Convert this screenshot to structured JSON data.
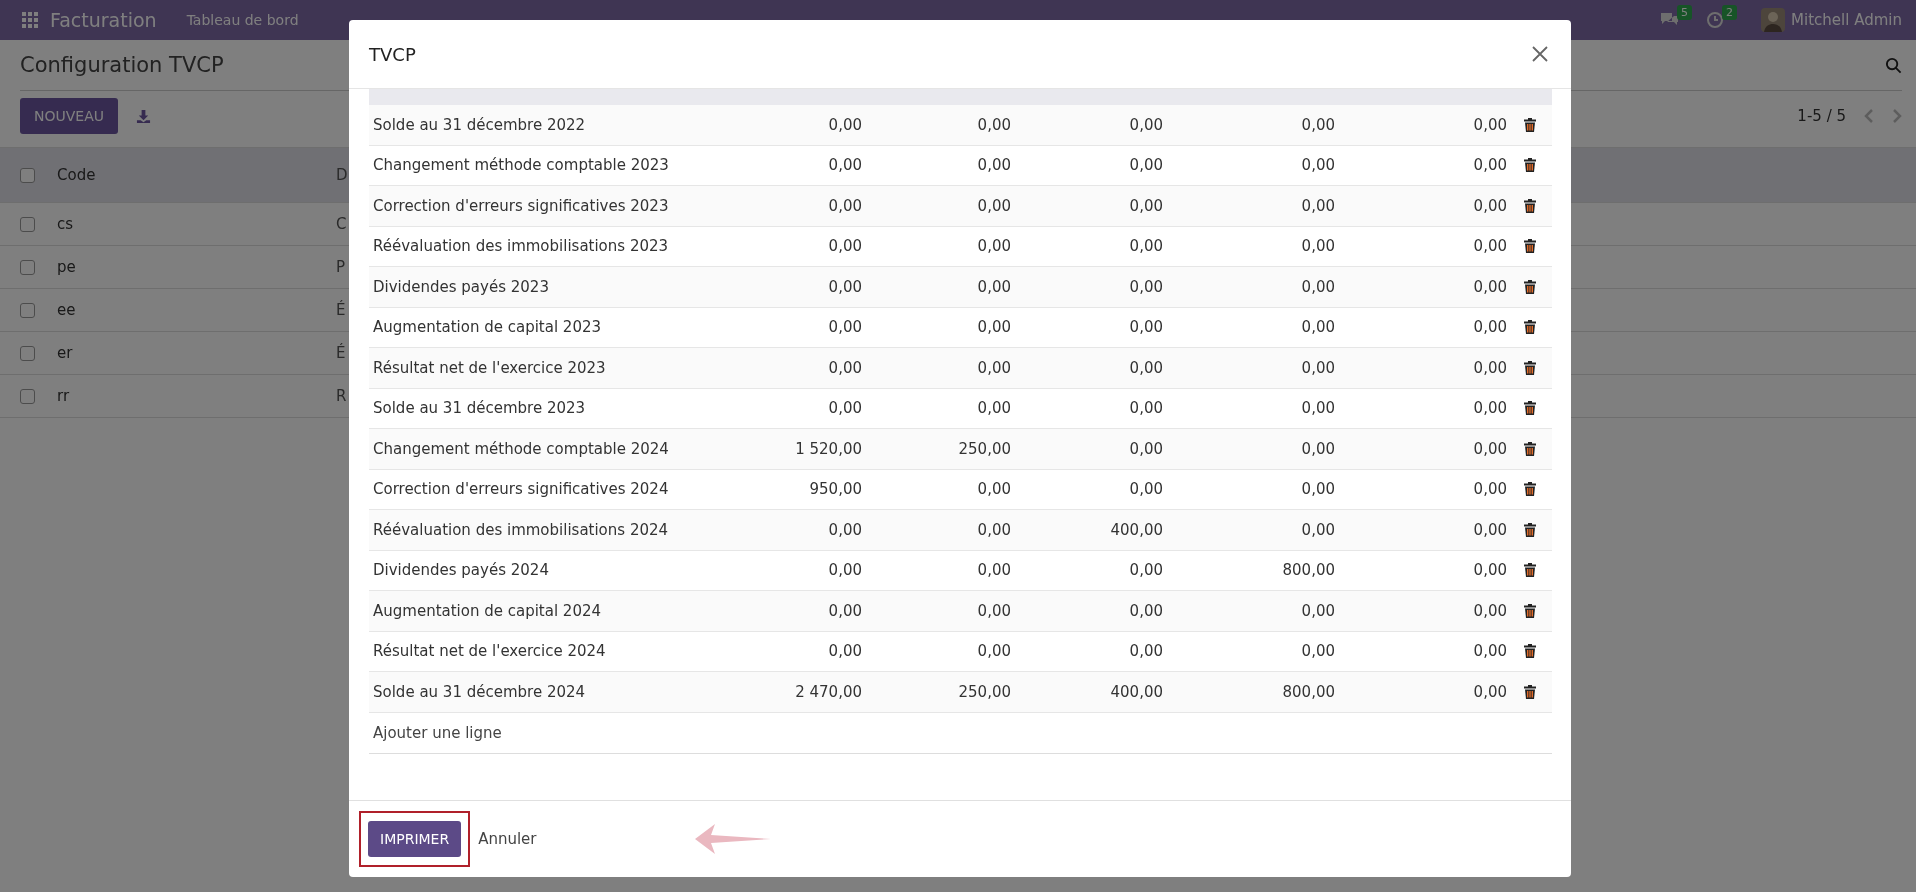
{
  "navbar": {
    "app_name": "Facturation",
    "menu": [
      "Tableau de bord"
    ],
    "messages_badge": "5",
    "activities_badge": "2",
    "user_name": "Mitchell Admin"
  },
  "page": {
    "title": "Configuration TVCP",
    "new_button": "NOUVEAU",
    "pager": "1-5 / 5",
    "list": {
      "columns": [
        "Code",
        "D"
      ],
      "header_checked": false,
      "rows": [
        {
          "code": "cs",
          "column_2": "C",
          "checked": false
        },
        {
          "code": "pe",
          "column_2": "P",
          "checked": false
        },
        {
          "code": "ee",
          "column_2": "É",
          "checked": false
        },
        {
          "code": "er",
          "column_2": "É",
          "checked": false
        },
        {
          "code": "rr",
          "column_2": "R",
          "checked": false
        }
      ]
    }
  },
  "dialog": {
    "title": "TVCP",
    "rows": [
      {
        "label": "Solde au 31 décembre 2022",
        "values": [
          "0,00",
          "0,00",
          "0,00",
          "0,00",
          "0,00"
        ]
      },
      {
        "label": "Changement méthode comptable 2023",
        "values": [
          "0,00",
          "0,00",
          "0,00",
          "0,00",
          "0,00"
        ]
      },
      {
        "label": "Correction d'erreurs significatives 2023",
        "values": [
          "0,00",
          "0,00",
          "0,00",
          "0,00",
          "0,00"
        ]
      },
      {
        "label": "Réévaluation des immobilisations 2023",
        "values": [
          "0,00",
          "0,00",
          "0,00",
          "0,00",
          "0,00"
        ]
      },
      {
        "label": "Dividendes payés 2023",
        "values": [
          "0,00",
          "0,00",
          "0,00",
          "0,00",
          "0,00"
        ]
      },
      {
        "label": "Augmentation de capital 2023",
        "values": [
          "0,00",
          "0,00",
          "0,00",
          "0,00",
          "0,00"
        ]
      },
      {
        "label": "Résultat net de l'exercice 2023",
        "values": [
          "0,00",
          "0,00",
          "0,00",
          "0,00",
          "0,00"
        ]
      },
      {
        "label": "Solde au 31 décembre 2023",
        "values": [
          "0,00",
          "0,00",
          "0,00",
          "0,00",
          "0,00"
        ]
      },
      {
        "label": "Changement méthode comptable 2024",
        "values": [
          "1 520,00",
          "250,00",
          "0,00",
          "0,00",
          "0,00"
        ]
      },
      {
        "label": "Correction d'erreurs significatives 2024",
        "values": [
          "950,00",
          "0,00",
          "0,00",
          "0,00",
          "0,00"
        ]
      },
      {
        "label": "Réévaluation des immobilisations 2024",
        "values": [
          "0,00",
          "0,00",
          "400,00",
          "0,00",
          "0,00"
        ]
      },
      {
        "label": "Dividendes payés 2024",
        "values": [
          "0,00",
          "0,00",
          "0,00",
          "800,00",
          "0,00"
        ]
      },
      {
        "label": "Augmentation de capital 2024",
        "values": [
          "0,00",
          "0,00",
          "0,00",
          "0,00",
          "0,00"
        ]
      },
      {
        "label": "Résultat net de l'exercice 2024",
        "values": [
          "0,00",
          "0,00",
          "0,00",
          "0,00",
          "0,00"
        ]
      },
      {
        "label": "Solde au 31 décembre 2024",
        "values": [
          "2 470,00",
          "250,00",
          "400,00",
          "800,00",
          "0,00"
        ]
      }
    ],
    "add_line": "Ajouter une ligne",
    "print_button": "IMPRIMER",
    "print_highlighted": true,
    "cancel_button": "Annuler"
  }
}
